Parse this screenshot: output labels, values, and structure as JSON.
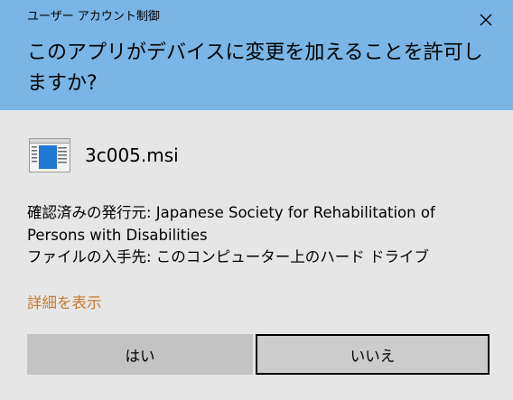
{
  "window": {
    "title": "ユーザー アカウント制御",
    "close_icon": "close-icon"
  },
  "header": {
    "question": "このアプリがデバイスに変更を加えることを許可しますか?",
    "background_color": "#7ab5e6"
  },
  "app": {
    "icon": "msi-installer-icon",
    "name": "3c005.msi"
  },
  "details": {
    "publisher_line": "確認済みの発行元: Japanese Society for Rehabilitation of Persons with Disabilities",
    "origin_line": "ファイルの入手先: このコンピューター上のハード ドライブ"
  },
  "more_details_link": "詳細を表示",
  "link_color": "#c87a30",
  "buttons": {
    "yes": "はい",
    "no": "いいえ"
  }
}
